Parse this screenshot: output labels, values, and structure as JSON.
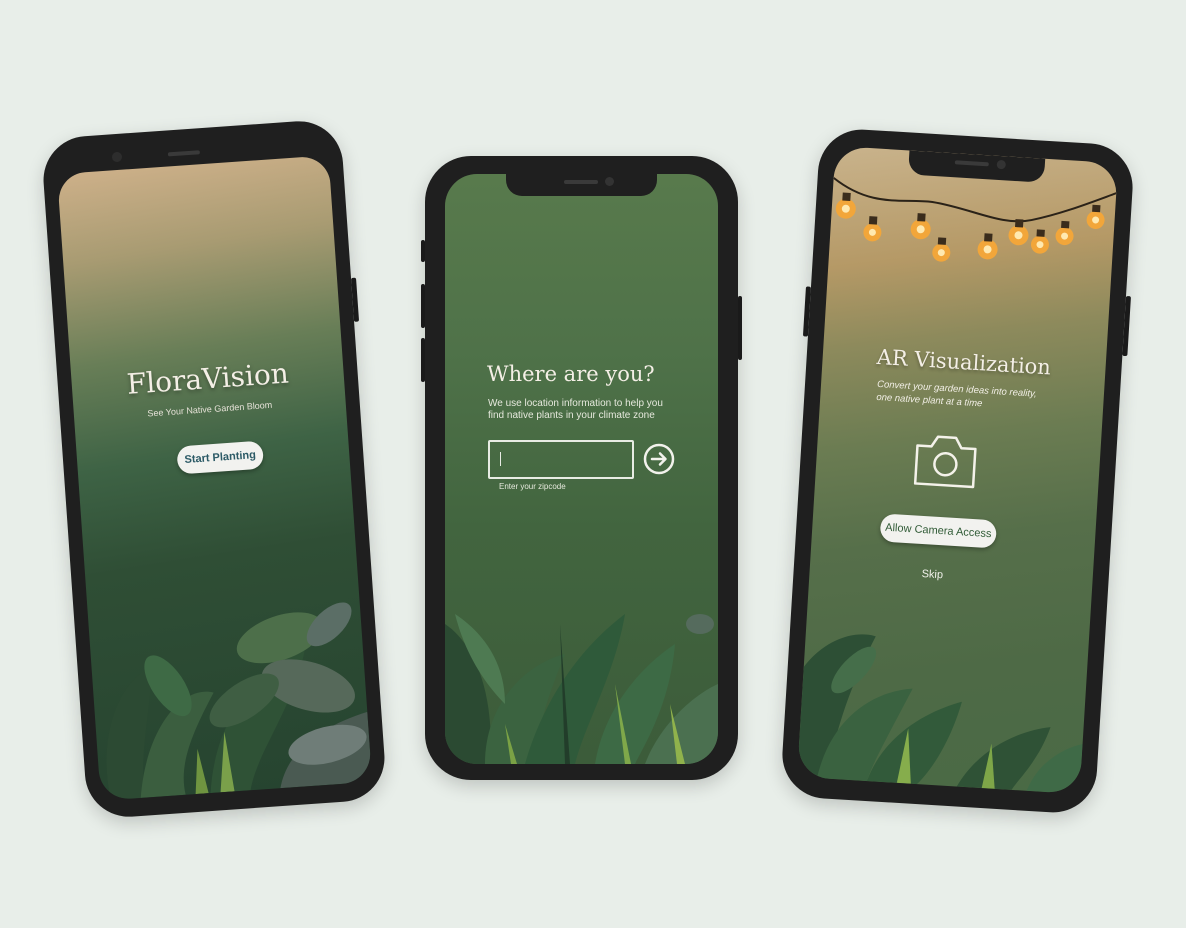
{
  "screens": {
    "welcome": {
      "app_title": "FloraVision",
      "tagline": "See Your Native Garden Bloom",
      "start_button_label": "Start Planting"
    },
    "location": {
      "title": "Where are you?",
      "description_line1": "We use location information to help you",
      "description_line2": "find native plants in your climate zone",
      "zipcode_value": "",
      "zipcode_caption": "Enter your zipcode",
      "submit_icon": "arrow-right-circle-icon"
    },
    "ar": {
      "title": "AR Visualization",
      "subtitle_line1": "Convert your garden ideas into reality,",
      "subtitle_line2": "one native plant at a time",
      "camera_icon": "camera-icon",
      "camera_button_label": "Allow Camera Access",
      "skip_label": "Skip"
    }
  },
  "colors": {
    "background": "#e8eee9",
    "device": "#1f1f1f",
    "deep_green": "#3f6443",
    "accent_teal": "#2c5a66"
  }
}
